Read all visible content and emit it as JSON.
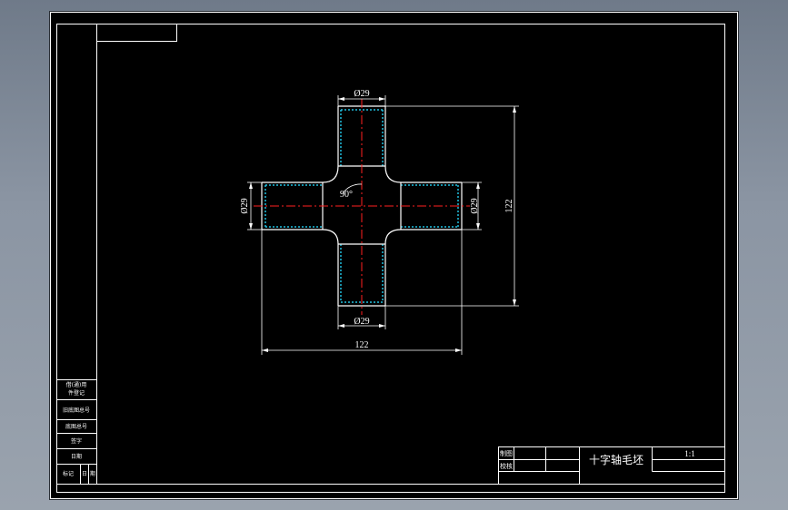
{
  "drawing": {
    "part_title": "十字轴毛坯",
    "scale": "1:1",
    "angle_label": "90°",
    "dimensions": {
      "top_diameter": "Ø29",
      "bottom_diameter": "Ø29",
      "left_diameter": "Ø29",
      "right_diameter": "Ø29",
      "overall_width": "122",
      "overall_height": "122"
    }
  },
  "title_block": {
    "drawn_label": "制图",
    "checked_label": "校核"
  },
  "side_table": {
    "rows": [
      "借(通)用",
      "件登记",
      "旧底图总号",
      "底图总号",
      "签字",
      "日期",
      "标记"
    ],
    "footer_cells": [
      "标记",
      "日",
      "期"
    ]
  },
  "colors": {
    "background": "#000000",
    "lines": "#ffffff",
    "centerline": "#ff2020",
    "hatch": "#20c0e0",
    "app_frame": "#8b95a3"
  }
}
